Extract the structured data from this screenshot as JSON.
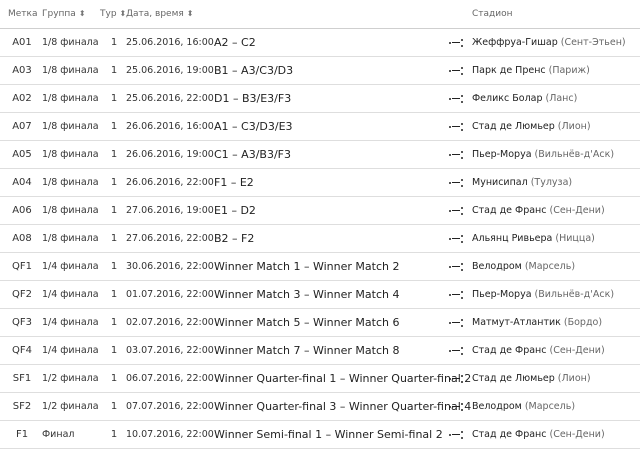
{
  "columns": {
    "label": "Метка",
    "group": "Группа",
    "tour": "Тур",
    "datetime": "Дата, время",
    "stadium": "Стадион"
  },
  "sort_icon": "sort-arrows-icon",
  "vs_icon": "versus-dots-icon",
  "rows": [
    {
      "label": "A01",
      "group": "1/8 финала",
      "tour": "1",
      "datetime": "25.06.2016, 16:00",
      "match": "A2 – C2",
      "stadium": "Жеффруа-Гишар",
      "city": "(Сент-Этьен)"
    },
    {
      "label": "A03",
      "group": "1/8 финала",
      "tour": "1",
      "datetime": "25.06.2016, 19:00",
      "match": "B1 – A3/C3/D3",
      "stadium": "Парк де Пренс",
      "city": "(Париж)"
    },
    {
      "label": "A02",
      "group": "1/8 финала",
      "tour": "1",
      "datetime": "25.06.2016, 22:00",
      "match": "D1 – B3/E3/F3",
      "stadium": "Феликс Болар",
      "city": "(Ланс)"
    },
    {
      "label": "A07",
      "group": "1/8 финала",
      "tour": "1",
      "datetime": "26.06.2016, 16:00",
      "match": "A1 – C3/D3/E3",
      "stadium": "Стад де Люмьер",
      "city": "(Лион)"
    },
    {
      "label": "A05",
      "group": "1/8 финала",
      "tour": "1",
      "datetime": "26.06.2016, 19:00",
      "match": "C1 – A3/B3/F3",
      "stadium": "Пьер-Моруа",
      "city": "(Вильнёв-д'Аск)"
    },
    {
      "label": "A04",
      "group": "1/8 финала",
      "tour": "1",
      "datetime": "26.06.2016, 22:00",
      "match": "F1 – E2",
      "stadium": "Мунисипал",
      "city": "(Тулуза)"
    },
    {
      "label": "A06",
      "group": "1/8 финала",
      "tour": "1",
      "datetime": "27.06.2016, 19:00",
      "match": "E1 – D2",
      "stadium": "Стад де Франс",
      "city": "(Сен-Дени)"
    },
    {
      "label": "A08",
      "group": "1/8 финала",
      "tour": "1",
      "datetime": "27.06.2016, 22:00",
      "match": "B2 – F2",
      "stadium": "Альянц Ривьера",
      "city": "(Ницца)"
    },
    {
      "label": "QF1",
      "group": "1/4 финала",
      "tour": "1",
      "datetime": "30.06.2016, 22:00",
      "match": "Winner Match 1 – Winner Match 2",
      "stadium": "Велодром",
      "city": "(Марсель)"
    },
    {
      "label": "QF2",
      "group": "1/4 финала",
      "tour": "1",
      "datetime": "01.07.2016, 22:00",
      "match": "Winner Match 3 – Winner Match 4",
      "stadium": "Пьер-Моруа",
      "city": "(Вильнёв-д'Аск)"
    },
    {
      "label": "QF3",
      "group": "1/4 финала",
      "tour": "1",
      "datetime": "02.07.2016, 22:00",
      "match": "Winner Match 5 – Winner Match 6",
      "stadium": "Матмут-Атлантик",
      "city": "(Бордо)"
    },
    {
      "label": "QF4",
      "group": "1/4 финала",
      "tour": "1",
      "datetime": "03.07.2016, 22:00",
      "match": "Winner Match 7 – Winner Match 8",
      "stadium": "Стад де Франс",
      "city": "(Сен-Дени)"
    },
    {
      "label": "SF1",
      "group": "1/2 финала",
      "tour": "1",
      "datetime": "06.07.2016, 22:00",
      "match": "Winner Quarter-final 1 – Winner Quarter-final 2",
      "stadium": "Стад де Люмьер",
      "city": "(Лион)"
    },
    {
      "label": "SF2",
      "group": "1/2 финала",
      "tour": "1",
      "datetime": "07.07.2016, 22:00",
      "match": "Winner Quarter-final 3 – Winner Quarter-final 4",
      "stadium": "Велодром",
      "city": "(Марсель)"
    },
    {
      "label": "F1",
      "group": "Финал",
      "tour": "1",
      "datetime": "10.07.2016, 22:00",
      "match": "Winner Semi-final 1 – Winner Semi-final 2",
      "stadium": "Стад де Франс",
      "city": "(Сен-Дени)"
    }
  ]
}
